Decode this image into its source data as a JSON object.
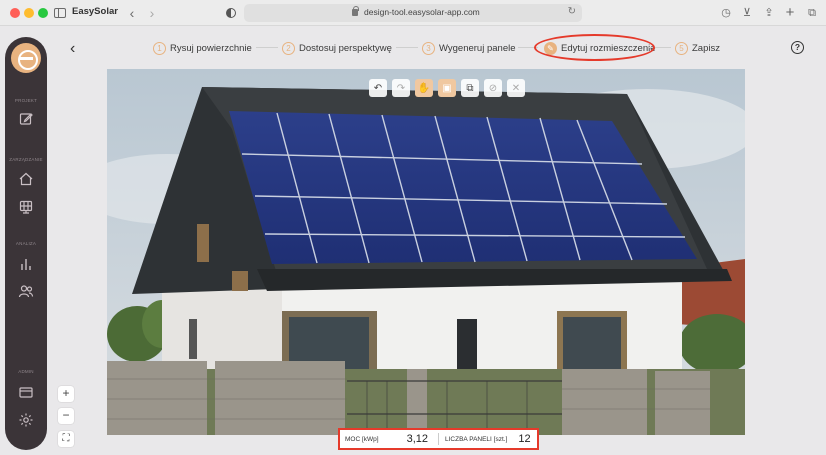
{
  "browser": {
    "tab_title": "EasySolar",
    "url": "design-tool.easysolar-app.com"
  },
  "sidebar": {
    "sections": [
      {
        "label": "PROJEKT"
      },
      {
        "label": "ZARZĄDZANIE"
      },
      {
        "label": "ANALIZA"
      },
      {
        "label": "ADMIN"
      }
    ]
  },
  "wizard": {
    "steps": [
      {
        "num": "1",
        "label": "Rysuj powierzchnie"
      },
      {
        "num": "2",
        "label": "Dostosuj perspektywę"
      },
      {
        "num": "3",
        "label": "Wygeneruj panele"
      },
      {
        "num": "",
        "label": "Edytuj rozmieszczenie"
      },
      {
        "num": "5",
        "label": "Zapisz"
      }
    ],
    "active_step": 4
  },
  "stats": {
    "power_label": "MOC [kWp]",
    "power_value": "3,12",
    "panels_label": "LICZBA PANELI [szt.]",
    "panels_value": "12"
  },
  "colors": {
    "accent": "#e8b380",
    "sidebar_bg": "#3b3438",
    "highlight": "#e53a2b"
  }
}
